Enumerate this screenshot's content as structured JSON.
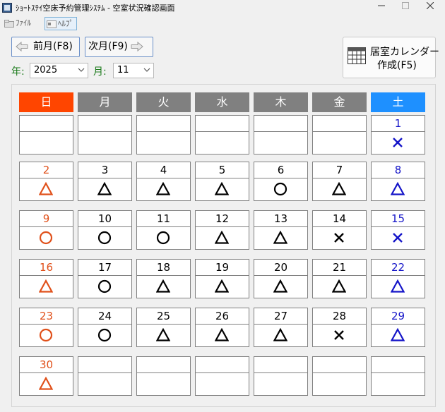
{
  "window": {
    "title": "ｼｮｰﾄｽﾃｲ空床予約管理ｼｽﾃﾑ - 空室状況確認画面"
  },
  "menu": {
    "file": "ﾌｧｲﾙ",
    "help": "ﾍﾙﾌﾟ"
  },
  "nav": {
    "prev_label": "前月(F8)",
    "next_label": "次月(F9)"
  },
  "selectors": {
    "year_label": "年:",
    "year_value": "2025",
    "month_label": "月:",
    "month_value": "11"
  },
  "create_button": {
    "line1": "居室カレンダー",
    "line2": "作成(F5)"
  },
  "colors": {
    "sunday_header": "#ff4500",
    "weekday_header": "#808080",
    "saturday_header": "#1e90ff",
    "sunday_text": "#e0501a",
    "saturday_text": "#1414c8",
    "weekday_text": "#000000"
  },
  "legend_symbols": {
    "circle": "○",
    "triangle": "△",
    "cross": "×"
  },
  "weekdays": [
    "日",
    "月",
    "火",
    "水",
    "木",
    "金",
    "土"
  ],
  "weeks": [
    [
      {
        "day": "",
        "mark": ""
      },
      {
        "day": "",
        "mark": ""
      },
      {
        "day": "",
        "mark": ""
      },
      {
        "day": "",
        "mark": ""
      },
      {
        "day": "",
        "mark": ""
      },
      {
        "day": "",
        "mark": ""
      },
      {
        "day": "1",
        "mark": "cross"
      }
    ],
    [
      {
        "day": "2",
        "mark": "triangle"
      },
      {
        "day": "3",
        "mark": "triangle"
      },
      {
        "day": "4",
        "mark": "triangle"
      },
      {
        "day": "5",
        "mark": "triangle"
      },
      {
        "day": "6",
        "mark": "circle"
      },
      {
        "day": "7",
        "mark": "triangle"
      },
      {
        "day": "8",
        "mark": "triangle"
      }
    ],
    [
      {
        "day": "9",
        "mark": "circle"
      },
      {
        "day": "10",
        "mark": "circle"
      },
      {
        "day": "11",
        "mark": "circle"
      },
      {
        "day": "12",
        "mark": "triangle"
      },
      {
        "day": "13",
        "mark": "triangle"
      },
      {
        "day": "14",
        "mark": "cross"
      },
      {
        "day": "15",
        "mark": "cross"
      }
    ],
    [
      {
        "day": "16",
        "mark": "triangle"
      },
      {
        "day": "17",
        "mark": "circle"
      },
      {
        "day": "18",
        "mark": "triangle"
      },
      {
        "day": "19",
        "mark": "triangle"
      },
      {
        "day": "20",
        "mark": "triangle"
      },
      {
        "day": "21",
        "mark": "triangle"
      },
      {
        "day": "22",
        "mark": "triangle"
      }
    ],
    [
      {
        "day": "23",
        "mark": "circle"
      },
      {
        "day": "24",
        "mark": "circle"
      },
      {
        "day": "25",
        "mark": "triangle"
      },
      {
        "day": "26",
        "mark": "triangle"
      },
      {
        "day": "27",
        "mark": "triangle"
      },
      {
        "day": "28",
        "mark": "cross"
      },
      {
        "day": "29",
        "mark": "triangle"
      }
    ],
    [
      {
        "day": "30",
        "mark": "triangle"
      },
      {
        "day": "",
        "mark": ""
      },
      {
        "day": "",
        "mark": ""
      },
      {
        "day": "",
        "mark": ""
      },
      {
        "day": "",
        "mark": ""
      },
      {
        "day": "",
        "mark": ""
      },
      {
        "day": "",
        "mark": ""
      }
    ]
  ]
}
